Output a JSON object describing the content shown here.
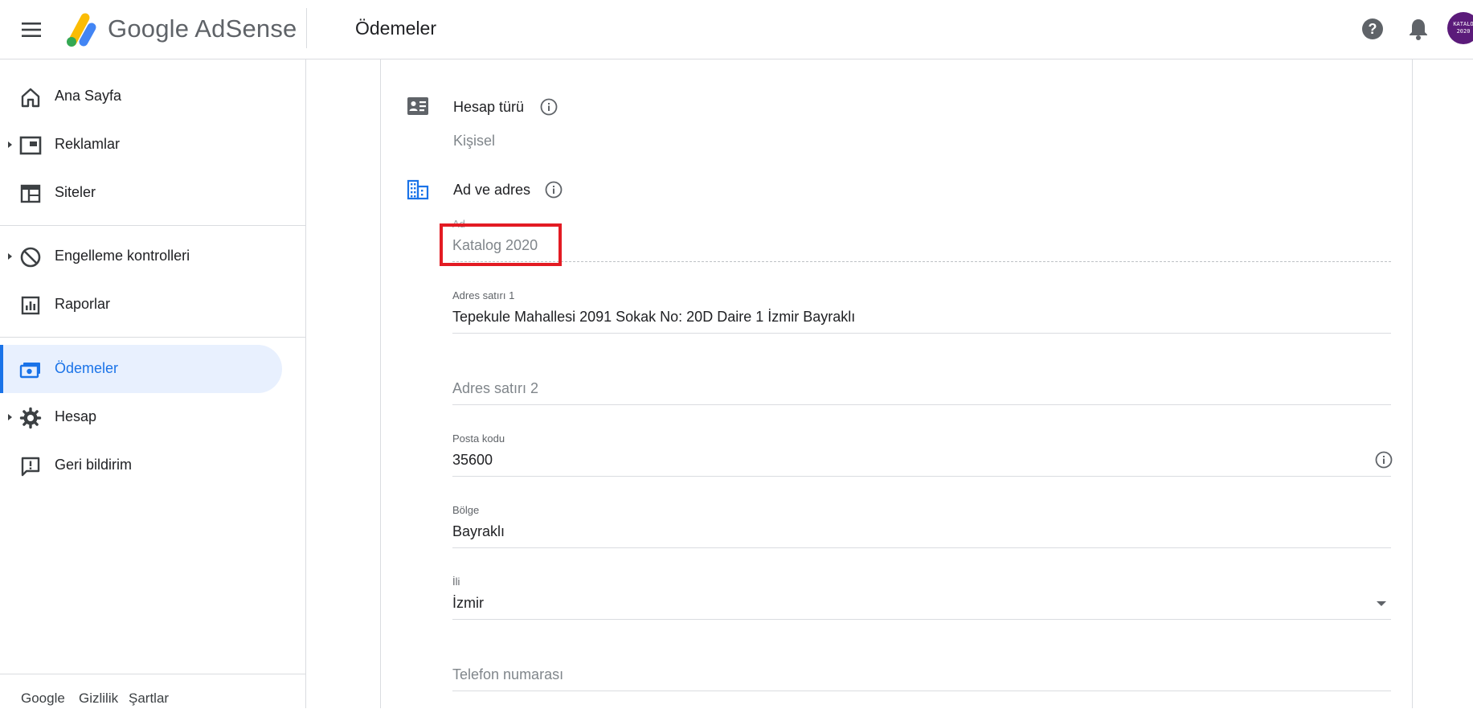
{
  "header": {
    "brand": "Google AdSense",
    "page_title": "Ödemeler",
    "avatar_line1": "KATALO",
    "avatar_line2": "2020",
    "icons": [
      "menu-icon",
      "help-icon",
      "bell-icon"
    ]
  },
  "sidebar": {
    "items": [
      {
        "label": "Ana Sayfa",
        "icon": "home-icon"
      },
      {
        "label": "Reklamlar",
        "icon": "ads-icon",
        "expandable": true
      },
      {
        "label": "Siteler",
        "icon": "sites-icon"
      },
      {
        "label": "Engelleme kontrolleri",
        "icon": "block-icon",
        "expandable": true
      },
      {
        "label": "Raporlar",
        "icon": "reports-icon"
      },
      {
        "label": "Ödemeler",
        "icon": "payments-icon",
        "active": true
      },
      {
        "label": "Hesap",
        "icon": "settings-icon",
        "expandable": true
      },
      {
        "label": "Geri bildirim",
        "icon": "feedback-icon"
      }
    ],
    "footer": [
      "Google",
      "Gizlilik",
      "Şartlar"
    ]
  },
  "account_type": {
    "title": "Hesap türü",
    "value": "Kişisel",
    "icon": "account-card-icon"
  },
  "name_address": {
    "title": "Ad ve adres",
    "icon": "business-icon",
    "fields": {
      "name": {
        "label": "Ad",
        "value": "Katalog 2020"
      },
      "address1": {
        "label": "Adres satırı 1",
        "value": "Tepekule Mahallesi 2091 Sokak No: 20D Daire 1 İzmir Bayraklı"
      },
      "address2": {
        "placeholder": "Adres satırı 2"
      },
      "postal": {
        "label": "Posta kodu",
        "value": "35600"
      },
      "region": {
        "label": "Bölge",
        "value": "Bayraklı"
      },
      "province": {
        "label": "İli",
        "value": "İzmir"
      },
      "phone": {
        "placeholder": "Telefon numarası"
      }
    }
  },
  "colors": {
    "accent": "#1a73e8",
    "active_bg": "#e8f0fe",
    "highlight": "#e31b23",
    "avatar_bg": "#5b1b7a"
  }
}
